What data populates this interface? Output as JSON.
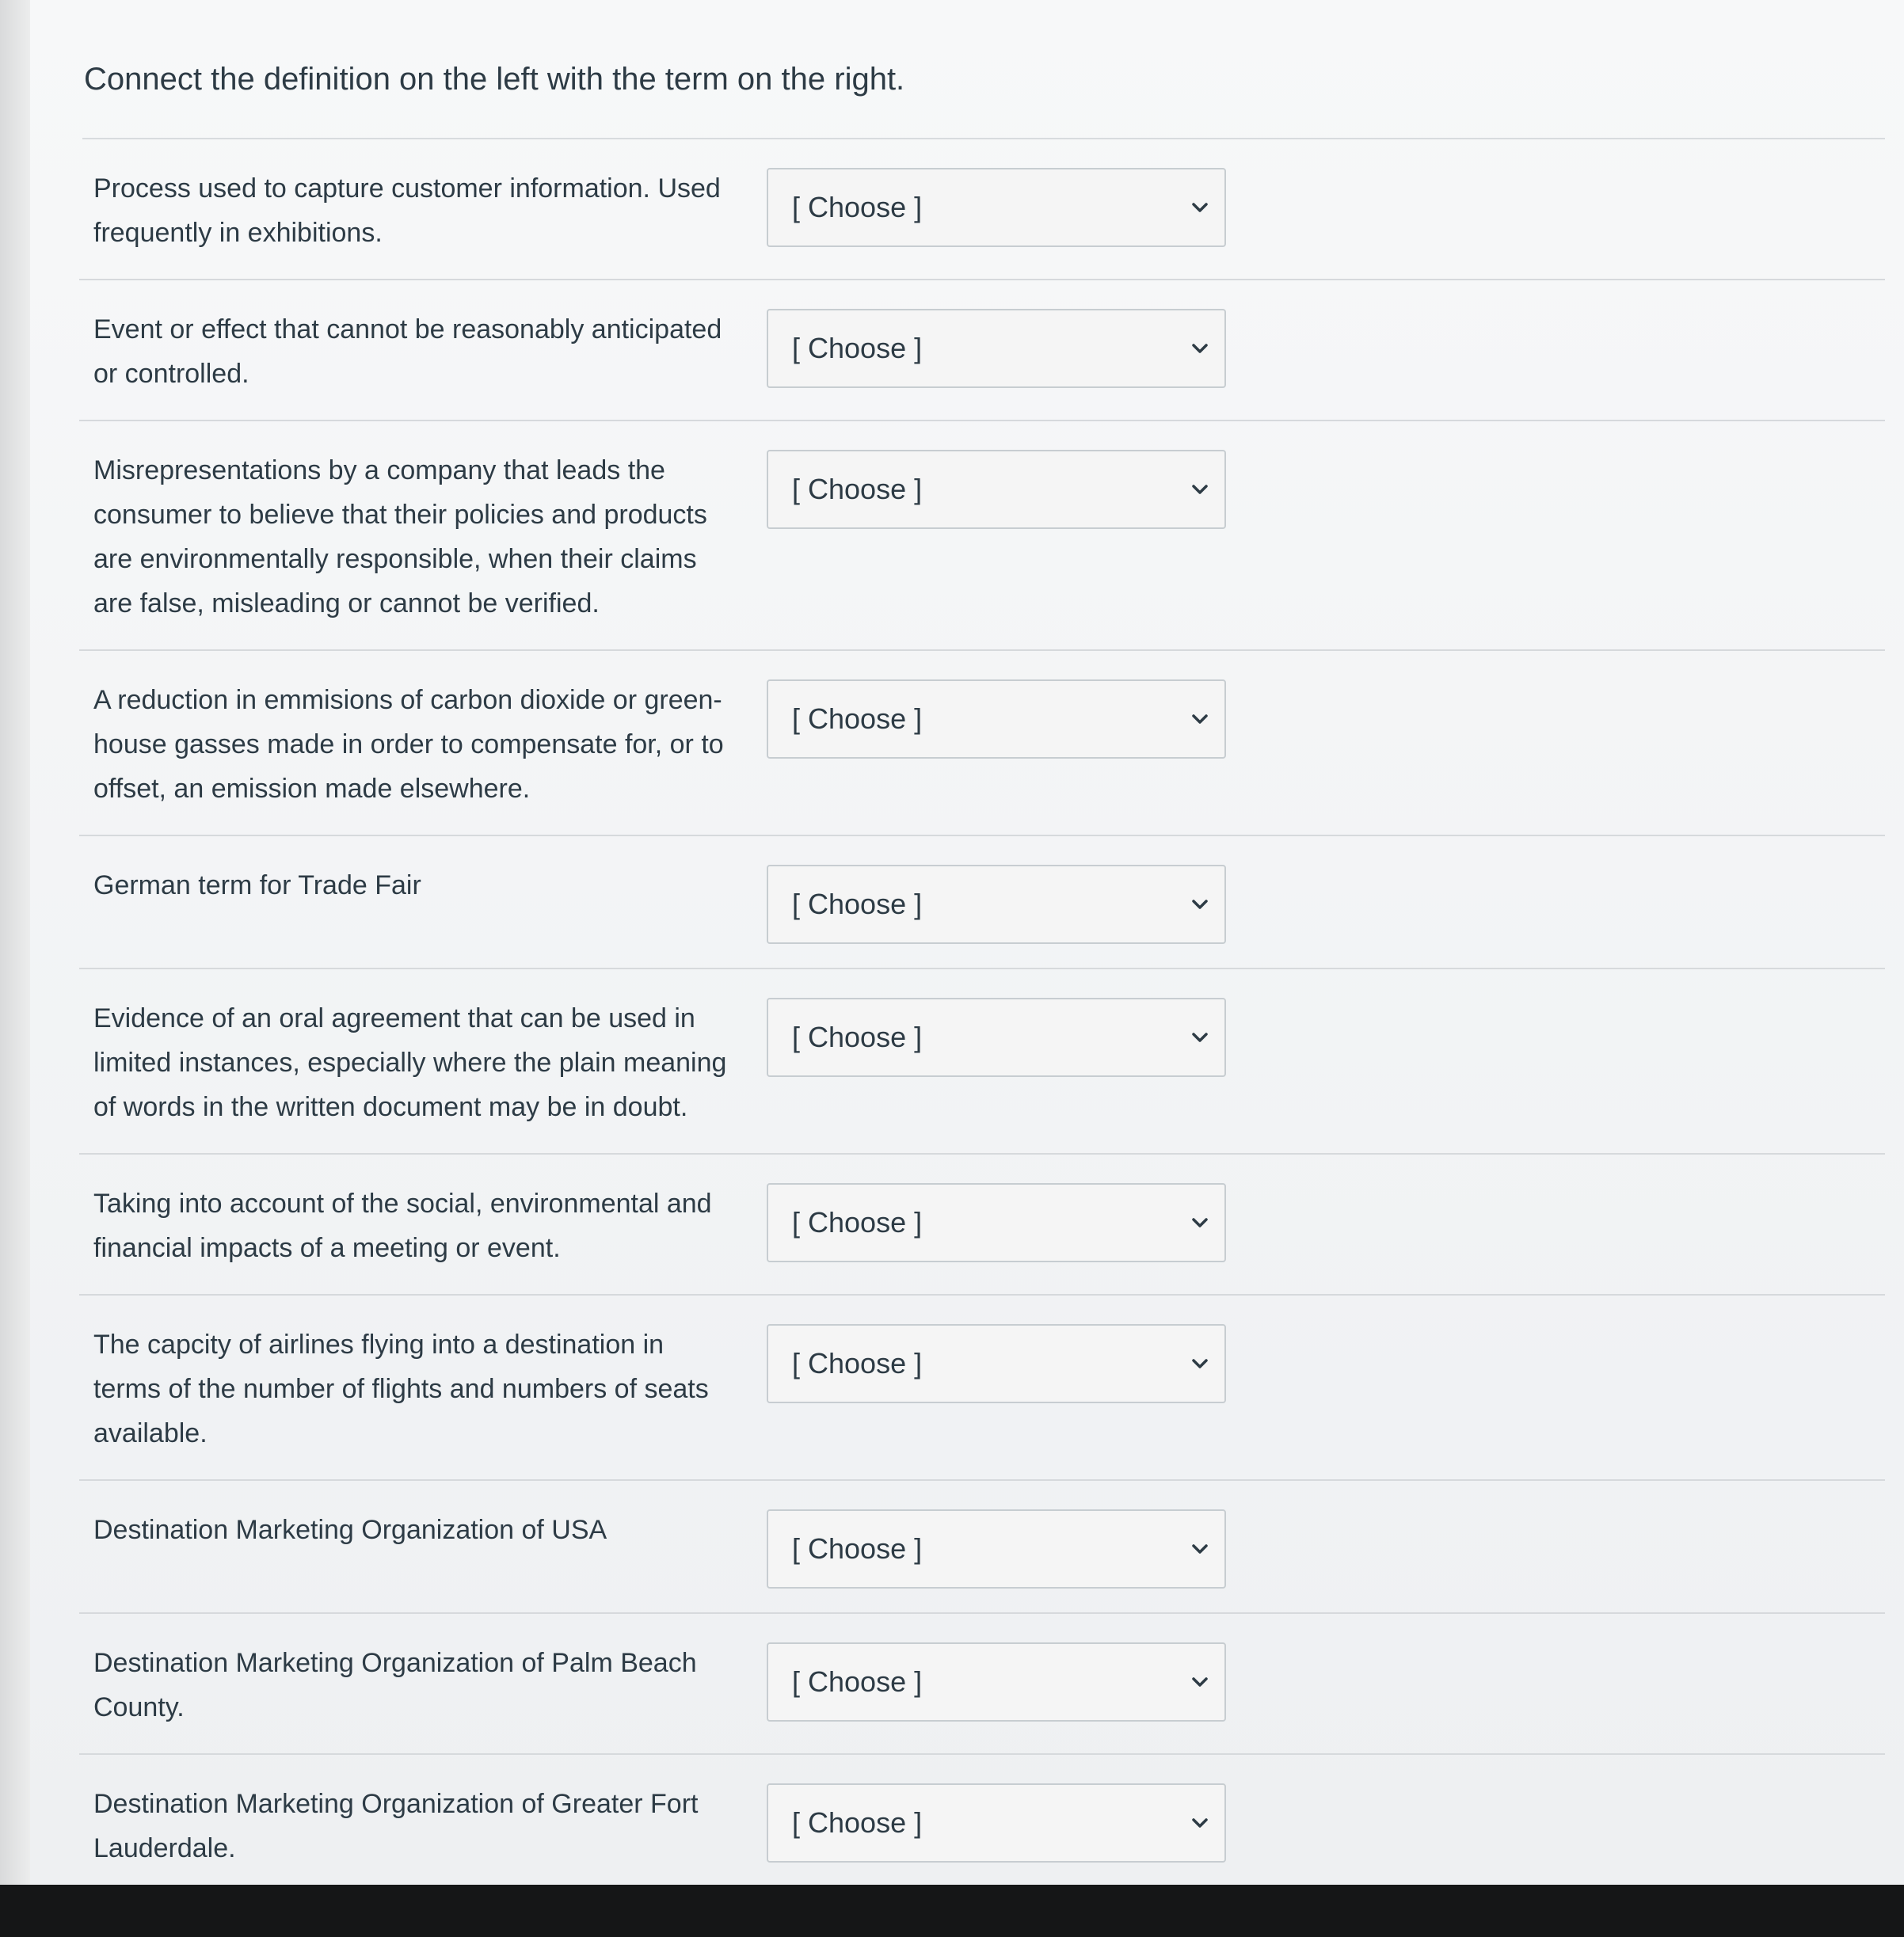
{
  "question": {
    "prompt": "Connect the definition on the left with the term on the right."
  },
  "matches": [
    {
      "definition": "Process used to capture customer information. Used frequently in exhibitions.",
      "selected": "[ Choose ]"
    },
    {
      "definition": "Event or effect that cannot be reasonably anticipated or controlled.",
      "selected": "[ Choose ]"
    },
    {
      "definition": "Misrepresentations by a company that leads the consumer to believe that their policies and products are environmentally responsible, when their claims are false, misleading or cannot be verified.",
      "selected": "[ Choose ]"
    },
    {
      "definition": "A reduction in emmisions of carbon dioxide or green-house gasses made in order to compensate for, or to offset, an emission made elsewhere.",
      "selected": "[ Choose ]"
    },
    {
      "definition": "German term for Trade Fair",
      "selected": "[ Choose ]"
    },
    {
      "definition": "Evidence of an oral agreement that can be used in limited instances, especially where the plain meaning of words in the written document may be in doubt.",
      "selected": "[ Choose ]"
    },
    {
      "definition": "Taking into account of the social, environmental and financial impacts of a meeting or event.",
      "selected": "[ Choose ]"
    },
    {
      "definition": "The capcity of airlines flying into a destination in terms of the number of flights and numbers of seats available.",
      "selected": "[ Choose ]"
    },
    {
      "definition": "Destination Marketing Organization of USA",
      "selected": "[ Choose ]"
    },
    {
      "definition": "Destination Marketing Organization of Palm Beach County.",
      "selected": "[ Choose ]"
    },
    {
      "definition": "Destination Marketing Organization of Greater Fort Lauderdale.",
      "selected": "[ Choose ]"
    }
  ],
  "icons": {
    "select_arrow": "chevron-down-icon"
  },
  "colors": {
    "text": "#2d3b45",
    "border": "#c7cdd1",
    "divider": "#d6d9dc"
  }
}
